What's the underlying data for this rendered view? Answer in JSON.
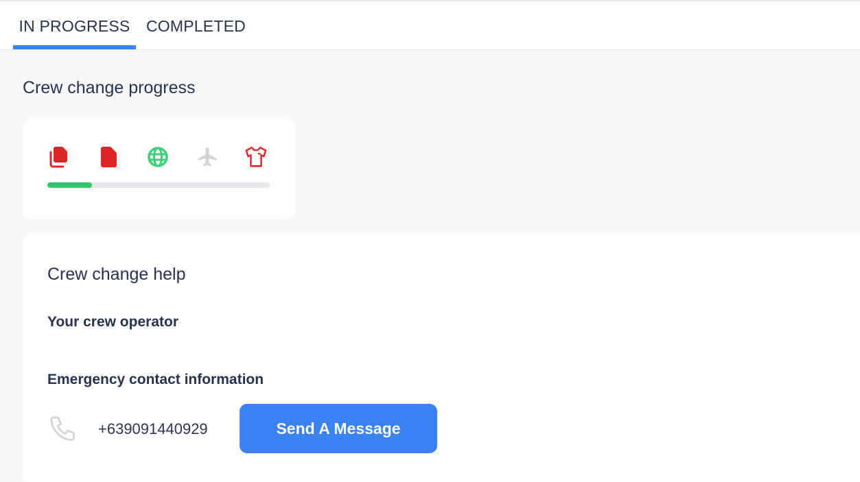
{
  "tabs": [
    {
      "label": "IN PROGRESS",
      "active": true
    },
    {
      "label": "COMPLETED",
      "active": false
    }
  ],
  "progress_section": {
    "title": "Crew change progress",
    "steps": [
      {
        "icon": "documents-icon",
        "status": "incomplete",
        "color": "#dc2626"
      },
      {
        "icon": "document-icon",
        "status": "incomplete",
        "color": "#dc2626"
      },
      {
        "icon": "globe-icon",
        "status": "complete",
        "color": "#3ccf78"
      },
      {
        "icon": "airplane-icon",
        "status": "pending",
        "color": "#d1d3d8"
      },
      {
        "icon": "shirt-icon",
        "status": "incomplete",
        "color": "#dc2626"
      }
    ],
    "progress_fraction": 0.2,
    "progress_color": "#2ec56b"
  },
  "help_section": {
    "title": "Crew change help",
    "operator_heading": "Your crew operator",
    "emergency_heading": "Emergency contact information",
    "phone_icon": "phone-icon",
    "phone_number": "+639091440929",
    "send_button_label": "Send A Message",
    "accent_color": "#3b82f0"
  }
}
